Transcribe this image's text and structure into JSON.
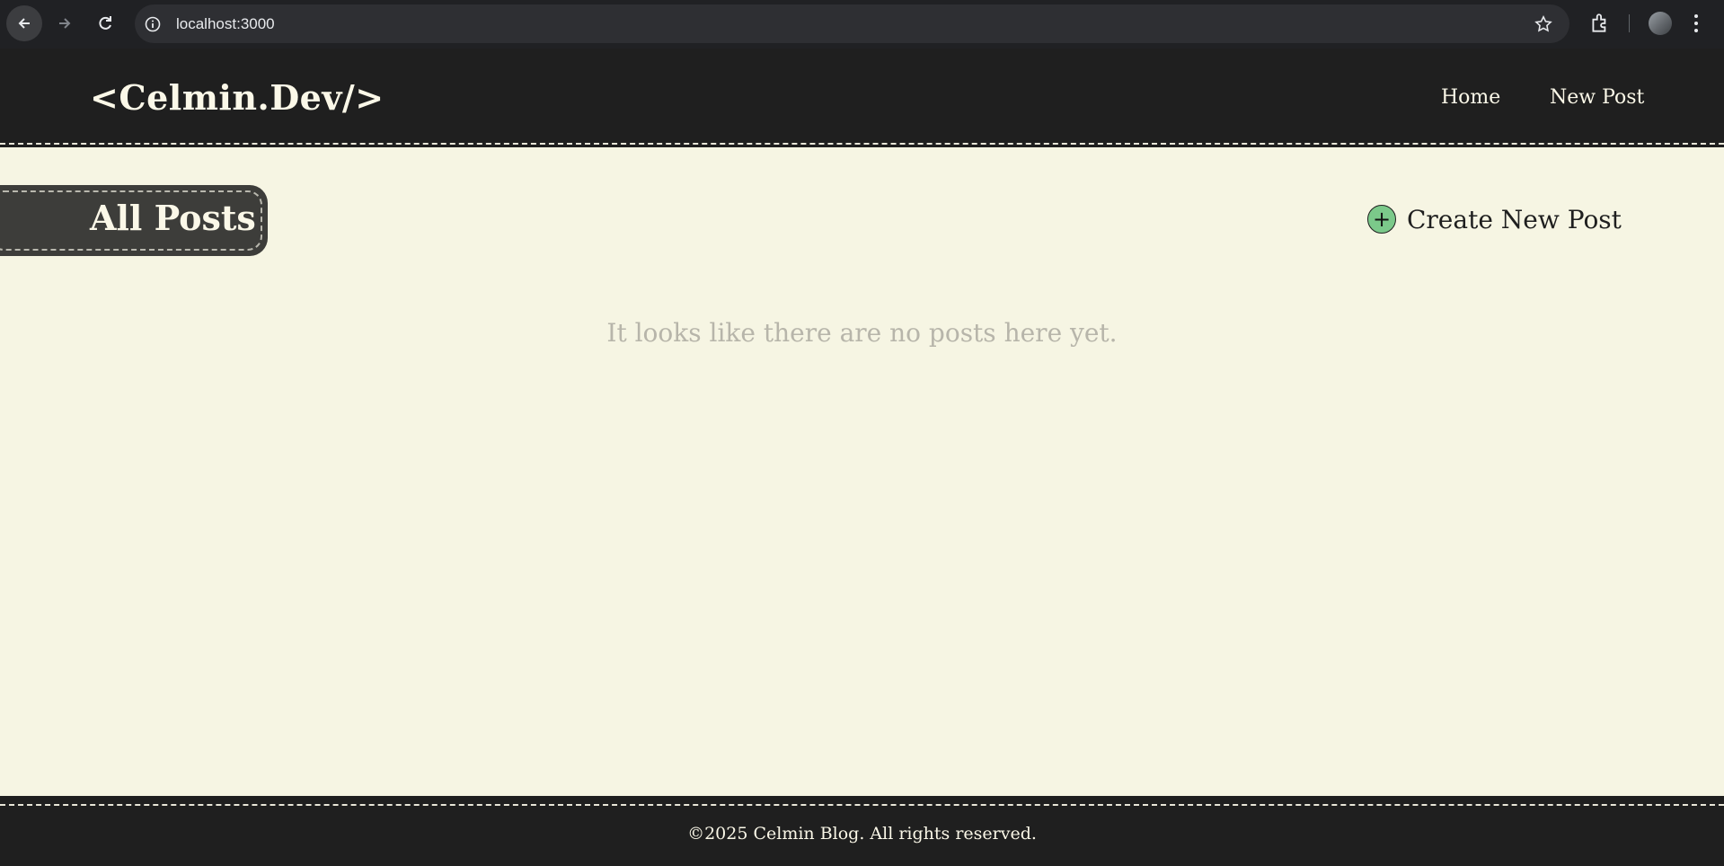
{
  "browser": {
    "url": "localhost:3000",
    "icons": [
      "back-arrow-icon",
      "forward-arrow-icon",
      "reload-icon",
      "info-icon",
      "star-icon",
      "extensions-icon",
      "profile-avatar",
      "more-menu-icon"
    ]
  },
  "header": {
    "logo": "<Celmin.Dev/>",
    "nav": [
      {
        "label": "Home"
      },
      {
        "label": "New Post"
      }
    ]
  },
  "main": {
    "section_title": "All Posts",
    "create_label": "Create New Post",
    "create_icon": "plus-icon",
    "empty_message": "It looks like there are no posts here yet."
  },
  "footer": {
    "text": "©2025 Celmin Blog. All rights reserved."
  },
  "colors": {
    "page_bg": "#f6f5e3",
    "header_bg": "#1f1f1f",
    "tab_bg": "#3d3d3a",
    "accent_green": "#7bc98a",
    "muted_text": "#b7b5aa"
  }
}
